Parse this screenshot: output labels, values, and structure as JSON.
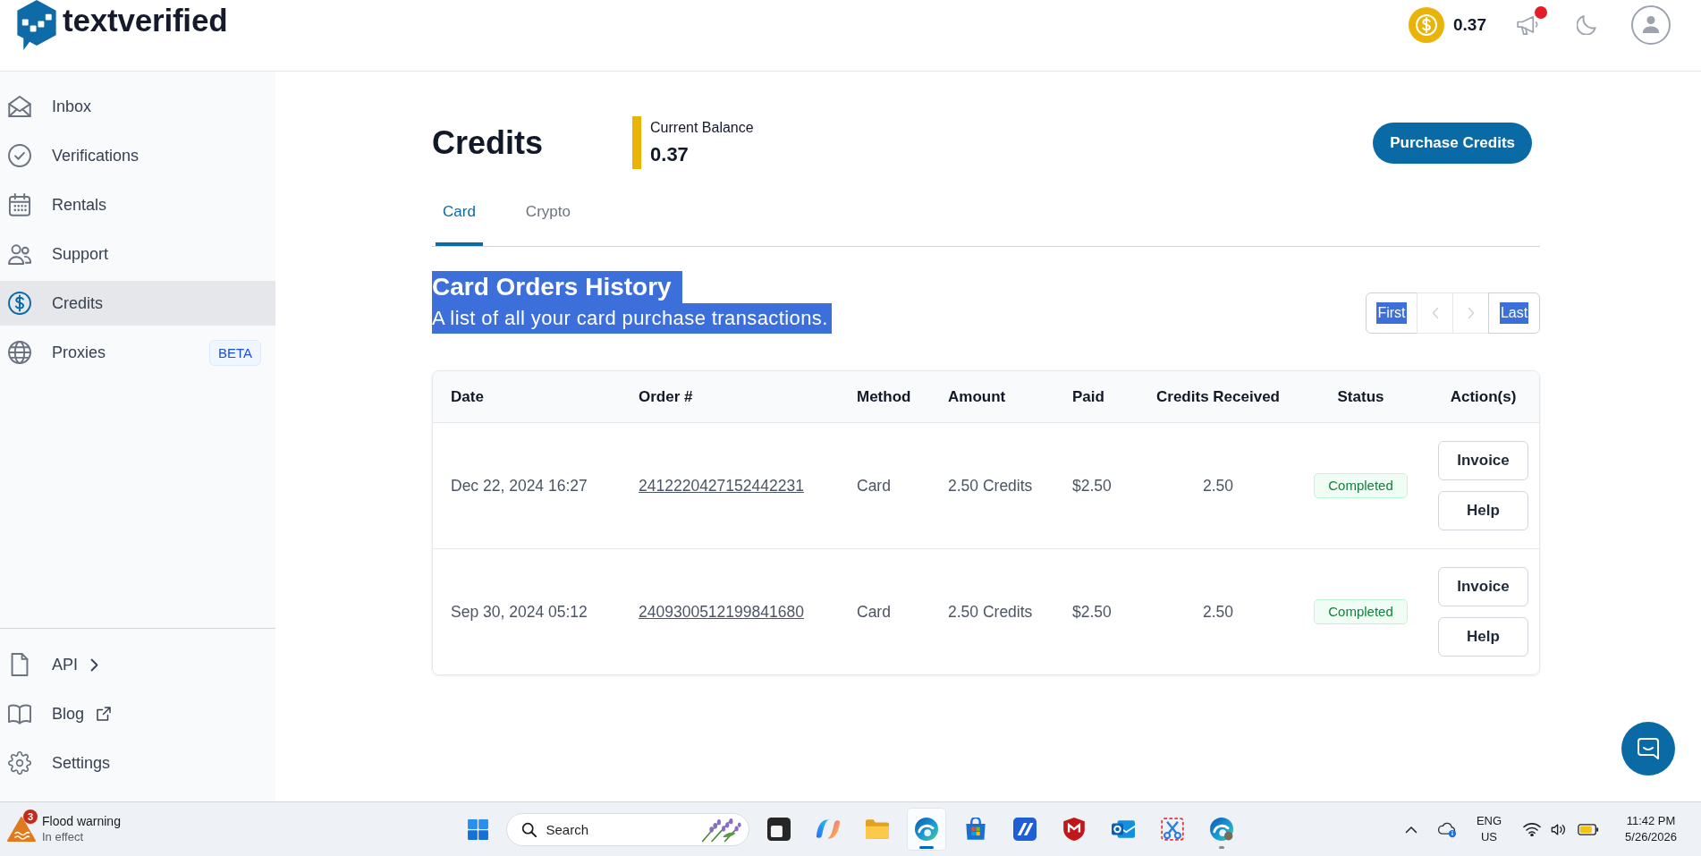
{
  "topbar": {
    "logo": "textverified",
    "balance": "0.37",
    "notifications": {
      "unread": true
    }
  },
  "sidebar": {
    "items": [
      {
        "label": "Inbox",
        "selected": false
      },
      {
        "label": "Verifications",
        "selected": false
      },
      {
        "label": "Rentals",
        "selected": false
      },
      {
        "label": "Support",
        "selected": false
      },
      {
        "label": "Credits",
        "selected": true
      },
      {
        "label": "Proxies",
        "selected": false,
        "badge": "BETA"
      }
    ],
    "footer_items": [
      {
        "label": "API"
      },
      {
        "label": "Blog"
      },
      {
        "label": "Settings"
      }
    ]
  },
  "page": {
    "title": "Credits",
    "balance": {
      "label": "Current Balance",
      "value": "0.37"
    },
    "purchase_button": "Purchase Credits",
    "tabs": [
      {
        "label": "Card",
        "selected": true
      },
      {
        "label": "Crypto",
        "selected": false
      }
    ],
    "history": {
      "title": "Card Orders History",
      "subtitle": "A list of all your card purchase transactions.",
      "text_selected": true
    },
    "pagination": [
      {
        "kind": "first",
        "label": "First",
        "disabled": false,
        "text_selected": true
      },
      {
        "kind": "prev",
        "disabled": true
      },
      {
        "kind": "next",
        "disabled": true
      },
      {
        "kind": "last",
        "label": "Last",
        "disabled": false,
        "text_selected": true
      }
    ],
    "table": {
      "columns": [
        "Date",
        "Order #",
        "Method",
        "Amount",
        "Paid",
        "Credits Received",
        "Status",
        "Action(s)"
      ],
      "rows": [
        {
          "date": "Dec 22, 2024 16:27",
          "order": "2412220427152442231",
          "method": "Card",
          "amount": "2.50 Credits",
          "paid": "$2.50",
          "credits_received": "2.50",
          "status": "Completed",
          "actions": [
            "Invoice",
            "Help"
          ]
        },
        {
          "date": "Sep 30, 2024 05:12",
          "order": "2409300512199841680",
          "method": "Card",
          "amount": "2.50 Credits",
          "paid": "$2.50",
          "credits_received": "2.50",
          "status": "Completed",
          "actions": [
            "Invoice",
            "Help"
          ]
        }
      ]
    }
  },
  "taskbar": {
    "weather": {
      "alert_count": "3",
      "title": "Flood warning",
      "subtitle": "In effect"
    },
    "search": {
      "placeholder": "Search"
    },
    "apps": [
      {
        "kind": "task-view",
        "active": false,
        "running": false
      },
      {
        "kind": "petals",
        "active": false,
        "running": false
      },
      {
        "kind": "folder",
        "active": false,
        "running": false
      },
      {
        "kind": "wave-circle",
        "active": true,
        "running": true
      },
      {
        "kind": "bag",
        "active": false,
        "running": false
      },
      {
        "kind": "striped-tile",
        "active": false,
        "running": false
      },
      {
        "kind": "shield",
        "active": false,
        "running": false
      },
      {
        "kind": "envelope",
        "active": false,
        "running": false
      },
      {
        "kind": "scissors",
        "active": false,
        "running": false
      },
      {
        "kind": "wave-circle-profile",
        "active": false,
        "running": true
      }
    ],
    "tray": {
      "language": "ENG",
      "region": "US",
      "time": "11:42 PM",
      "date": "5/26/2026"
    }
  }
}
